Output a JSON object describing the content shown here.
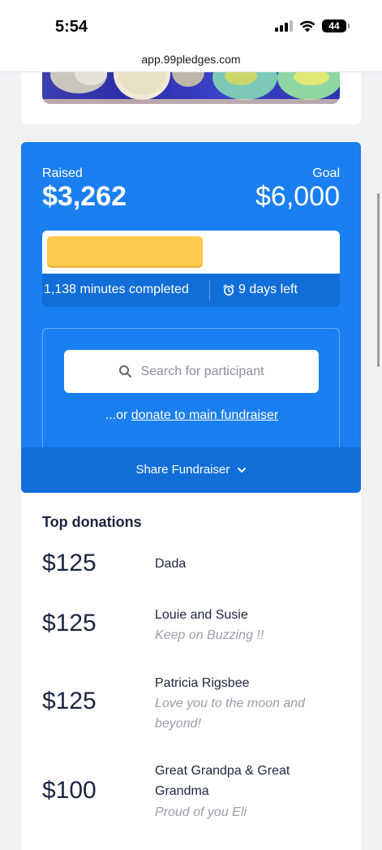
{
  "status": {
    "time": "5:54",
    "battery": "44"
  },
  "browser": {
    "url": "app.99pledges.com"
  },
  "fundraiser": {
    "raised_label": "Raised",
    "raised_amount": "$3,262",
    "goal_label": "Goal",
    "goal_amount": "$6,000",
    "progress_fraction": 0.54,
    "minutes_completed": "1,138 minutes completed",
    "days_left": "9 days left",
    "search_placeholder": "Search for participant",
    "or_prefix": "...or ",
    "donate_link": "donate to main fundraiser",
    "share_label": "Share Fundraiser"
  },
  "donations": {
    "title": "Top donations",
    "items": [
      {
        "amount": "$125",
        "name": "Dada",
        "message": ""
      },
      {
        "amount": "$125",
        "name": "Louie and Susie",
        "message": "Keep on Buzzing !!"
      },
      {
        "amount": "$125",
        "name": "Patricia Rigsbee",
        "message": "Love you to the moon and beyond!"
      },
      {
        "amount": "$100",
        "name": "Great Grandpa & Great Grandma",
        "message": "Proud of you Eli"
      }
    ]
  },
  "colors": {
    "brand_blue": "#1a7ff0",
    "brand_blue_dark": "#116ed8",
    "progress_yellow": "#ffc94d"
  },
  "icons": {
    "search": "search-icon",
    "alarm": "alarm-icon",
    "chevron": "chevron-down-icon"
  }
}
